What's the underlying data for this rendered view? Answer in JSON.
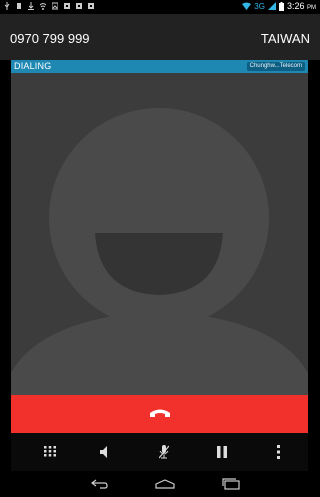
{
  "status_bar": {
    "network": "3G",
    "time": "3:26",
    "ampm": "PM",
    "left_icons": [
      "usb-icon",
      "storage-icon",
      "download-icon",
      "wifi-icon",
      "gallery-icon",
      "screenshot-icon",
      "screenshot-icon",
      "screenshot-icon"
    ],
    "right_icons": [
      "wifi-icon",
      "signal-icon",
      "battery-icon"
    ]
  },
  "call": {
    "number": "0970 799 999",
    "location": "TAIWAN",
    "state": "DIALING",
    "carrier": "Chunghw...Telecom"
  },
  "colors": {
    "dial_bar": "#1e88b3",
    "end_call": "#f2302c",
    "photo_bg": "#3c3c3c",
    "accent_3g": "#33b5e5"
  },
  "controls": [
    "dialpad-icon",
    "speaker-icon",
    "mute-icon",
    "hold-icon",
    "more-icon"
  ],
  "nav": [
    "back-icon",
    "home-icon",
    "recents-icon"
  ]
}
